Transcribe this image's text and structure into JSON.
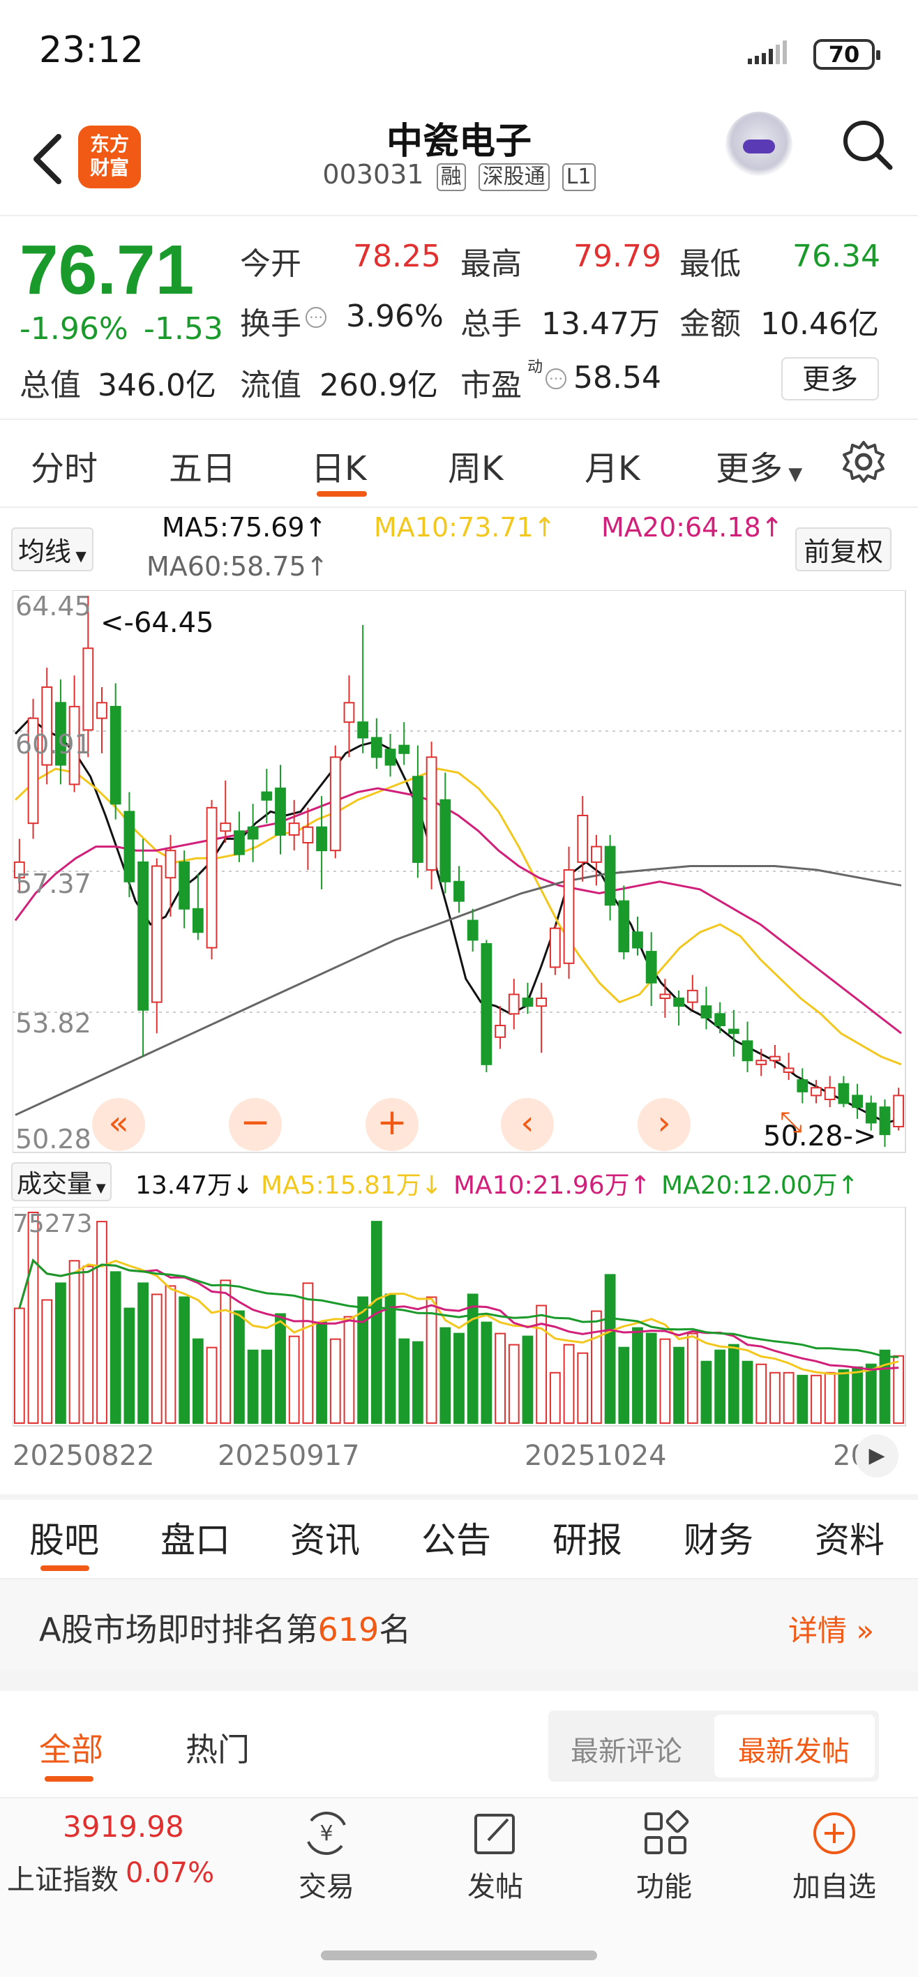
{
  "status": {
    "time": "23:12",
    "battery": "70"
  },
  "header": {
    "stock_name": "中瓷电子",
    "code": "003031",
    "tags": [
      "融",
      "深股通",
      "L1"
    ],
    "logo_line1": "东方",
    "logo_line2": "财富"
  },
  "quote": {
    "price": "76.71",
    "change_pct": "-1.96%",
    "change_amt": "-1.53",
    "open_label": "今开",
    "open": "78.25",
    "high_label": "最高",
    "high": "79.79",
    "low_label": "最低",
    "low": "76.34",
    "turnover_label": "换手",
    "turnover": "3.96%",
    "volume_label": "总手",
    "volume": "13.47万",
    "amount_label": "金额",
    "amount": "10.46亿",
    "mktcap_label": "总值",
    "mktcap": "346.0亿",
    "float_label": "流值",
    "float": "260.9亿",
    "pe_label": "市盈",
    "pe_sup": "动",
    "pe": "58.54",
    "more": "更多"
  },
  "period_tabs": [
    "分时",
    "五日",
    "日K",
    "周K",
    "月K",
    "更多"
  ],
  "active_period": "日K",
  "ma": {
    "selector": "均线",
    "ma5": "MA5:75.69↑",
    "ma10": "MA10:73.71↑",
    "ma20": "MA20:64.18↑",
    "ma60": "MA60:58.75↑",
    "adjust": "前复权"
  },
  "volume_bar": {
    "selector": "成交量",
    "vol": "13.47万↓",
    "ma5": "MA5:15.81万↓",
    "ma10": "MA10:21.96万↑",
    "ma20": "MA20:12.00万↑"
  },
  "colors": {
    "up": "#e03030",
    "down": "#1a9a2a",
    "ma5": "#111111",
    "ma10": "#f2c71e",
    "ma20": "#d0207a",
    "ma60": "#666666",
    "accent": "#f05a14"
  },
  "chart_data": {
    "type": "candlestick",
    "price_axis_ticks": [
      "64.45",
      "60.91",
      "57.37",
      "53.82",
      "50.28"
    ],
    "ylim": [
      50.28,
      64.45
    ],
    "high_marker": "<-64.45",
    "low_marker": "50.28->",
    "volume_axis_max": "75273",
    "date_labels": [
      "20250822",
      "20250917",
      "20251024",
      "20"
    ],
    "candles": [
      {
        "o": 57.2,
        "h": 58.2,
        "l": 56.8,
        "c": 57.6
      },
      {
        "o": 58.6,
        "h": 61.8,
        "l": 58.2,
        "c": 61.3
      },
      {
        "o": 60.1,
        "h": 62.6,
        "l": 59.6,
        "c": 62.1
      },
      {
        "o": 61.7,
        "h": 62.3,
        "l": 59.6,
        "c": 60.1
      },
      {
        "o": 59.6,
        "h": 62.4,
        "l": 59.4,
        "c": 61.6
      },
      {
        "o": 61.0,
        "h": 64.45,
        "l": 60.3,
        "c": 63.1
      },
      {
        "o": 61.3,
        "h": 62.1,
        "l": 60.4,
        "c": 61.7
      },
      {
        "o": 61.6,
        "h": 62.2,
        "l": 58.7,
        "c": 59.1
      },
      {
        "o": 58.9,
        "h": 59.4,
        "l": 56.7,
        "c": 57.1
      },
      {
        "o": 57.6,
        "h": 58.2,
        "l": 52.6,
        "c": 53.8
      },
      {
        "o": 54.0,
        "h": 57.7,
        "l": 53.2,
        "c": 57.5
      },
      {
        "o": 57.2,
        "h": 58.3,
        "l": 56.2,
        "c": 57.9
      },
      {
        "o": 57.6,
        "h": 57.9,
        "l": 55.9,
        "c": 56.4
      },
      {
        "o": 56.4,
        "h": 57.3,
        "l": 55.6,
        "c": 55.8
      },
      {
        "o": 55.4,
        "h": 59.2,
        "l": 55.1,
        "c": 59.0
      },
      {
        "o": 58.4,
        "h": 59.7,
        "l": 58.1,
        "c": 58.6
      },
      {
        "o": 58.4,
        "h": 58.9,
        "l": 57.6,
        "c": 57.8
      },
      {
        "o": 58.5,
        "h": 59.1,
        "l": 57.6,
        "c": 58.2
      },
      {
        "o": 59.4,
        "h": 60.0,
        "l": 58.6,
        "c": 59.2
      },
      {
        "o": 59.5,
        "h": 60.1,
        "l": 57.8,
        "c": 58.3
      },
      {
        "o": 58.3,
        "h": 59.2,
        "l": 57.9,
        "c": 58.6
      },
      {
        "o": 58.1,
        "h": 59.0,
        "l": 57.4,
        "c": 58.5
      },
      {
        "o": 58.5,
        "h": 59.3,
        "l": 56.9,
        "c": 57.9
      },
      {
        "o": 57.9,
        "h": 60.6,
        "l": 57.7,
        "c": 60.3
      },
      {
        "o": 61.2,
        "h": 62.4,
        "l": 60.3,
        "c": 61.7
      },
      {
        "o": 61.2,
        "h": 63.7,
        "l": 60.4,
        "c": 60.8
      },
      {
        "o": 60.8,
        "h": 61.3,
        "l": 60.0,
        "c": 60.3
      },
      {
        "o": 60.5,
        "h": 60.9,
        "l": 59.8,
        "c": 60.1
      },
      {
        "o": 60.6,
        "h": 61.2,
        "l": 60.1,
        "c": 60.4
      },
      {
        "o": 59.8,
        "h": 60.6,
        "l": 57.2,
        "c": 57.6
      },
      {
        "o": 57.4,
        "h": 60.7,
        "l": 56.9,
        "c": 60.3
      },
      {
        "o": 59.2,
        "h": 59.9,
        "l": 56.8,
        "c": 57.1
      },
      {
        "o": 57.1,
        "h": 57.5,
        "l": 56.3,
        "c": 56.6
      },
      {
        "o": 56.1,
        "h": 56.4,
        "l": 55.3,
        "c": 55.6
      },
      {
        "o": 55.5,
        "h": 55.6,
        "l": 52.2,
        "c": 52.4
      },
      {
        "o": 53.1,
        "h": 53.9,
        "l": 52.8,
        "c": 53.4
      },
      {
        "o": 53.7,
        "h": 54.6,
        "l": 53.3,
        "c": 54.2
      },
      {
        "o": 54.1,
        "h": 54.5,
        "l": 53.7,
        "c": 53.9
      },
      {
        "o": 53.9,
        "h": 54.5,
        "l": 52.7,
        "c": 54.1
      },
      {
        "o": 54.9,
        "h": 56.0,
        "l": 54.7,
        "c": 55.9
      },
      {
        "o": 55.0,
        "h": 58.0,
        "l": 54.6,
        "c": 57.4
      },
      {
        "o": 57.6,
        "h": 59.3,
        "l": 57.1,
        "c": 58.8
      },
      {
        "o": 57.6,
        "h": 58.3,
        "l": 57.0,
        "c": 58.0
      },
      {
        "o": 58.0,
        "h": 58.3,
        "l": 56.1,
        "c": 56.5
      },
      {
        "o": 56.6,
        "h": 57.0,
        "l": 55.1,
        "c": 55.3
      },
      {
        "o": 55.8,
        "h": 56.2,
        "l": 55.2,
        "c": 55.4
      },
      {
        "o": 55.3,
        "h": 55.8,
        "l": 53.9,
        "c": 54.5
      },
      {
        "o": 54.1,
        "h": 54.6,
        "l": 53.6,
        "c": 54.2
      },
      {
        "o": 54.1,
        "h": 54.3,
        "l": 53.4,
        "c": 53.9
      },
      {
        "o": 54.0,
        "h": 54.7,
        "l": 53.8,
        "c": 54.3
      },
      {
        "o": 53.9,
        "h": 54.4,
        "l": 53.3,
        "c": 53.6
      },
      {
        "o": 53.7,
        "h": 54.0,
        "l": 53.2,
        "c": 53.4
      },
      {
        "o": 53.3,
        "h": 53.8,
        "l": 52.6,
        "c": 53.2
      },
      {
        "o": 53.0,
        "h": 53.5,
        "l": 52.2,
        "c": 52.5
      },
      {
        "o": 52.4,
        "h": 52.8,
        "l": 52.1,
        "c": 52.5
      },
      {
        "o": 52.5,
        "h": 52.9,
        "l": 52.3,
        "c": 52.6
      },
      {
        "o": 52.2,
        "h": 52.7,
        "l": 52.0,
        "c": 52.3
      },
      {
        "o": 52.0,
        "h": 52.3,
        "l": 51.4,
        "c": 51.7
      },
      {
        "o": 51.6,
        "h": 52.0,
        "l": 51.4,
        "c": 51.8
      },
      {
        "o": 51.5,
        "h": 52.1,
        "l": 51.3,
        "c": 51.8
      },
      {
        "o": 51.9,
        "h": 52.1,
        "l": 51.3,
        "c": 51.4
      },
      {
        "o": 51.6,
        "h": 51.9,
        "l": 51.0,
        "c": 51.3
      },
      {
        "o": 51.4,
        "h": 51.6,
        "l": 50.7,
        "c": 50.9
      },
      {
        "o": 51.3,
        "h": 51.5,
        "l": 50.28,
        "c": 50.6
      },
      {
        "o": 50.8,
        "h": 51.8,
        "l": 50.7,
        "c": 51.6
      }
    ],
    "volumes": [
      41000,
      75273,
      44000,
      50000,
      58000,
      56000,
      72000,
      54000,
      41000,
      50000,
      46000,
      49000,
      45000,
      30000,
      27000,
      51000,
      40000,
      26000,
      26000,
      39000,
      31000,
      50000,
      36000,
      30000,
      38000,
      45000,
      72000,
      46000,
      30000,
      29000,
      45000,
      34000,
      32000,
      46000,
      36000,
      32000,
      28000,
      31000,
      42000,
      18000,
      28000,
      25000,
      40000,
      53000,
      27000,
      34000,
      32000,
      30000,
      27000,
      32000,
      22000,
      26000,
      28000,
      22000,
      21000,
      18000,
      18000,
      17000,
      17000,
      18000,
      19000,
      20000,
      21000,
      26000,
      24000
    ],
    "ma_values": {
      "MA5": [
        60.9,
        61.3,
        61.0,
        60.8,
        60.4,
        59.8,
        58.8,
        57.7,
        56.6,
        56.0,
        56.2,
        56.9,
        57.2,
        57.6,
        58.2,
        58.2,
        58.6,
        58.9,
        58.8,
        58.9,
        59.4,
        59.9,
        60.4,
        60.6,
        60.7,
        60.5,
        59.7,
        58.8,
        57.5,
        56.1,
        54.6,
        54.0,
        53.9,
        53.7,
        53.9,
        54.9,
        56.0,
        57.3,
        57.6,
        57.3,
        56.6,
        56.0,
        55.1,
        54.5,
        54.1,
        53.8,
        53.6,
        53.3,
        53.0,
        52.8,
        52.6,
        52.4,
        52.1,
        51.9,
        51.7,
        51.5,
        51.3,
        51.1,
        50.9,
        51.0
      ],
      "MA10": [
        59.2,
        59.7,
        60.0,
        59.9,
        59.5,
        59.0,
        58.4,
        57.9,
        57.6,
        57.7,
        57.7,
        57.8,
        58.0,
        58.3,
        58.4,
        58.7,
        58.9,
        59.2,
        59.4,
        59.6,
        59.8,
        60.0,
        59.9,
        59.5,
        58.9,
        58.0,
        57.0,
        56.0,
        55.2,
        54.5,
        54.0,
        54.2,
        54.8,
        55.4,
        55.8,
        56.0,
        55.7,
        55.1,
        54.6,
        54.1,
        53.7,
        53.2,
        52.9,
        52.6,
        52.4
      ],
      "MA20": [
        56.1,
        56.8,
        57.3,
        57.7,
        58.0,
        58.0,
        57.9,
        57.9,
        58.0,
        58.1,
        58.2,
        58.3,
        58.5,
        58.6,
        58.8,
        59.0,
        59.2,
        59.4,
        59.5,
        59.4,
        59.3,
        59.1,
        58.8,
        58.4,
        57.9,
        57.5,
        57.2,
        57.0,
        56.9,
        56.8,
        56.9,
        57.0,
        57.1,
        57.0,
        56.9,
        56.6,
        56.3,
        56.0,
        55.6,
        55.2,
        54.8,
        54.4,
        54.0,
        53.6,
        53.2
      ],
      "MA60": [
        51.1,
        51.6,
        52.1,
        52.6,
        53.1,
        53.6,
        54.1,
        54.6,
        55.1,
        55.6,
        56.0,
        56.4,
        56.8,
        57.1,
        57.3,
        57.4,
        57.5,
        57.5,
        57.5,
        57.4,
        57.2,
        57.0
      ]
    }
  },
  "bottom_tabs": [
    "股吧",
    "盘口",
    "资讯",
    "公告",
    "研报",
    "财务",
    "资料"
  ],
  "ranking": {
    "prefix": "A股市场即时排名第",
    "rank": "619",
    "suffix": "名",
    "detail": "详情"
  },
  "feed_tabs": {
    "all": "全部",
    "hot": "热门",
    "latest_comment": "最新评论",
    "latest_post": "最新发帖"
  },
  "index": {
    "value": "3919.98",
    "name": "上证指数",
    "change": "0.07%"
  },
  "nav": [
    "交易",
    "发帖",
    "功能",
    "加自选"
  ]
}
